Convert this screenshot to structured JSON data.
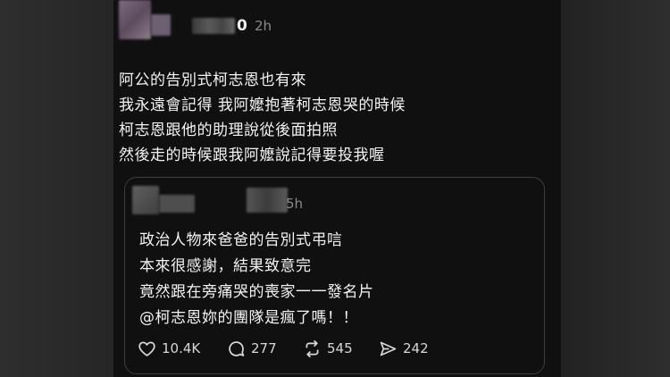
{
  "post": {
    "author_visible_suffix": "0",
    "time": "2h",
    "lines": [
      "阿公的告別式柯志恩也有來",
      "我永遠會記得 我阿嬤抱著柯志恩哭的時候",
      "柯志恩跟他的助理說從後面拍照",
      "然後走的時候跟我阿嬤說記得要投我喔"
    ]
  },
  "quoted": {
    "time": "5h",
    "lines": [
      "政治人物來爸爸的告別式弔唁",
      "本來很感謝，結果致意完",
      "竟然跟在旁痛哭的喪家一一發名片",
      "@柯志恩妳的團隊是瘋了嗎！！"
    ],
    "actions": {
      "likes": "10.4K",
      "replies": "277",
      "reposts": "545",
      "shares": "242"
    }
  },
  "icons": [
    "heart-icon",
    "comment-icon",
    "repost-icon",
    "share-icon"
  ],
  "colors": {
    "background": "#101010",
    "text": "#f3f3f3",
    "muted": "#8a8a8a",
    "border": "#3d3d3d"
  }
}
